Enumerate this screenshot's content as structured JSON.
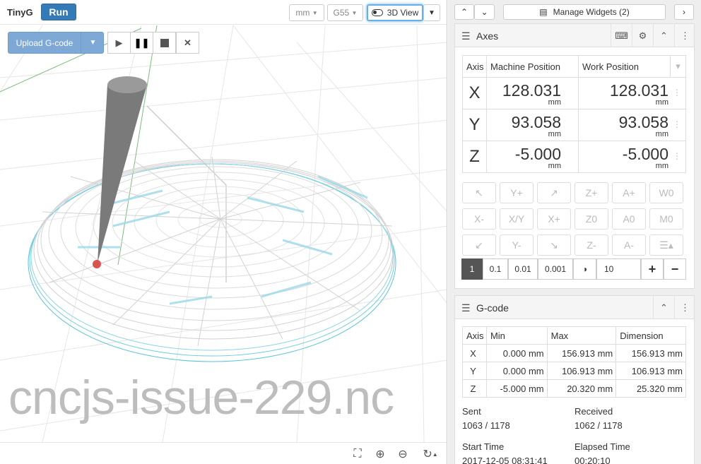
{
  "toolbar": {
    "controller": "TinyG",
    "run_label": "Run",
    "units": "mm",
    "wcs": "G55",
    "view_label": "3D View"
  },
  "workspace": {
    "upload_label": "Upload G-code",
    "file_name": "cncjs-issue-229.nc"
  },
  "widgets": {
    "manage_label": "Manage Widgets (2)"
  },
  "axes": {
    "title": "Axes",
    "headers": {
      "axis": "Axis",
      "machine": "Machine Position",
      "work": "Work Position"
    },
    "rows": [
      {
        "axis": "X",
        "machine": "128.031",
        "work": "128.031",
        "unit": "mm"
      },
      {
        "axis": "Y",
        "machine": "93.058",
        "work": "93.058",
        "unit": "mm"
      },
      {
        "axis": "Z",
        "machine": "-5.000",
        "work": "-5.000",
        "unit": "mm"
      }
    ],
    "jog": {
      "y_plus": "Y+",
      "z_plus": "Z+",
      "a_plus": "A+",
      "w0": "W0",
      "x_minus": "X-",
      "xy": "X/Y",
      "x_plus": "X+",
      "z0": "Z0",
      "a0": "A0",
      "m0": "M0",
      "y_minus": "Y-",
      "z_minus": "Z-",
      "a_minus": "A-"
    },
    "steps": [
      "1",
      "0.1",
      "0.01",
      "0.001"
    ],
    "custom_step": "10"
  },
  "gcode": {
    "title": "G-code",
    "headers": {
      "axis": "Axis",
      "min": "Min",
      "max": "Max",
      "dim": "Dimension"
    },
    "rows": [
      {
        "axis": "X",
        "min": "0.000 mm",
        "max": "156.913 mm",
        "dim": "156.913 mm"
      },
      {
        "axis": "Y",
        "min": "0.000 mm",
        "max": "106.913 mm",
        "dim": "106.913 mm"
      },
      {
        "axis": "Z",
        "min": "-5.000 mm",
        "max": "20.320 mm",
        "dim": "25.320 mm"
      }
    ],
    "sent_label": "Sent",
    "sent_value": "1063 / 1178",
    "received_label": "Received",
    "received_value": "1062 / 1178",
    "start_label": "Start Time",
    "start_value": "2017-12-05 08:31:41",
    "elapsed_label": "Elapsed Time",
    "elapsed_value": "00:20:10"
  }
}
